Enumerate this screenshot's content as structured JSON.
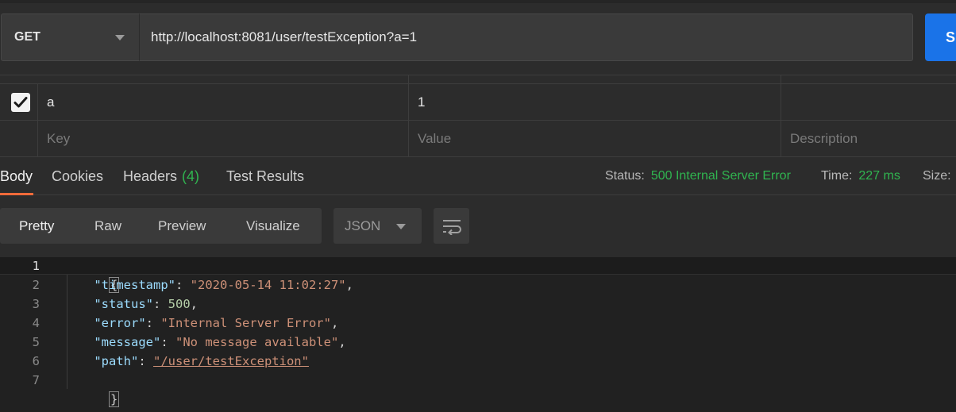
{
  "request": {
    "method": "GET",
    "url": "http://localhost:8081/user/testException?a=1",
    "send_label": "S"
  },
  "params": {
    "rows": [
      {
        "checked": true,
        "key": "a",
        "value": "1",
        "description": ""
      }
    ],
    "placeholders": {
      "key": "Key",
      "value": "Value",
      "description": "Description"
    }
  },
  "response": {
    "tabs": [
      {
        "label": "Body",
        "active": true
      },
      {
        "label": "Cookies"
      },
      {
        "label": "Headers",
        "count": "(4)"
      },
      {
        "label": "Test Results"
      }
    ],
    "status_label": "Status:",
    "status_value": "500 Internal Server Error",
    "time_label": "Time:",
    "time_value": "227 ms",
    "size_label": "Size:"
  },
  "format": {
    "modes": [
      "Pretty",
      "Raw",
      "Preview",
      "Visualize"
    ],
    "active_mode": "Pretty",
    "language": "JSON"
  },
  "body": {
    "line_numbers": [
      "1",
      "2",
      "3",
      "4",
      "5",
      "6",
      "7"
    ],
    "open_brace": "{",
    "close_brace": "}",
    "fields": [
      {
        "key": "\"timestamp\"",
        "value": "\"2020-05-14 11:02:27\"",
        "type": "string",
        "comma": ","
      },
      {
        "key": "\"status\"",
        "value": "500",
        "type": "number",
        "comma": ","
      },
      {
        "key": "\"error\"",
        "value": "\"Internal Server Error\"",
        "type": "string",
        "comma": ","
      },
      {
        "key": "\"message\"",
        "value": "\"No message available\"",
        "type": "string",
        "comma": ","
      },
      {
        "key": "\"path\"",
        "value": "\"/user/testException\"",
        "type": "link",
        "comma": ""
      }
    ]
  },
  "colors": {
    "accent_tab": "#f26b3a",
    "status_ok_text": "#30b550",
    "send_button": "#1a73e8"
  }
}
